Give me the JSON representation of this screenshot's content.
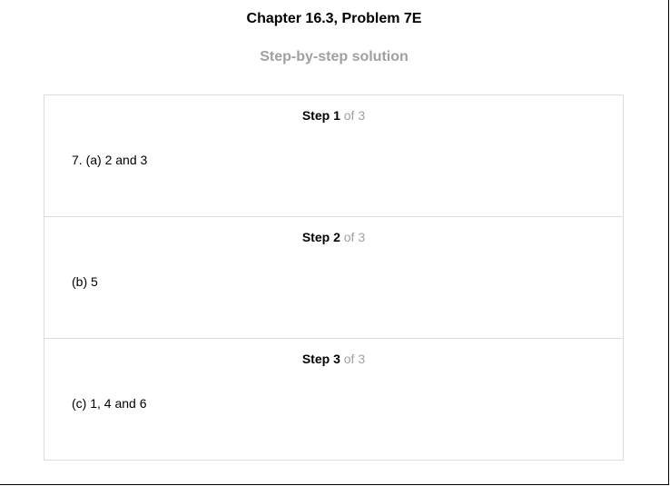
{
  "header": {
    "title": "Chapter 16.3, Problem 7E",
    "subtitle": "Step-by-step solution"
  },
  "steps": [
    {
      "word": "Step",
      "number": "1",
      "of": "of",
      "total": "3",
      "content": "7. (a) 2 and 3"
    },
    {
      "word": "Step",
      "number": "2",
      "of": "of",
      "total": "3",
      "content": "(b) 5"
    },
    {
      "word": "Step",
      "number": "3",
      "of": "of",
      "total": "3",
      "content": "(c) 1, 4 and 6"
    }
  ],
  "colors": {
    "muted_text": "#a0a0a0",
    "border": "#dcdcdc"
  }
}
